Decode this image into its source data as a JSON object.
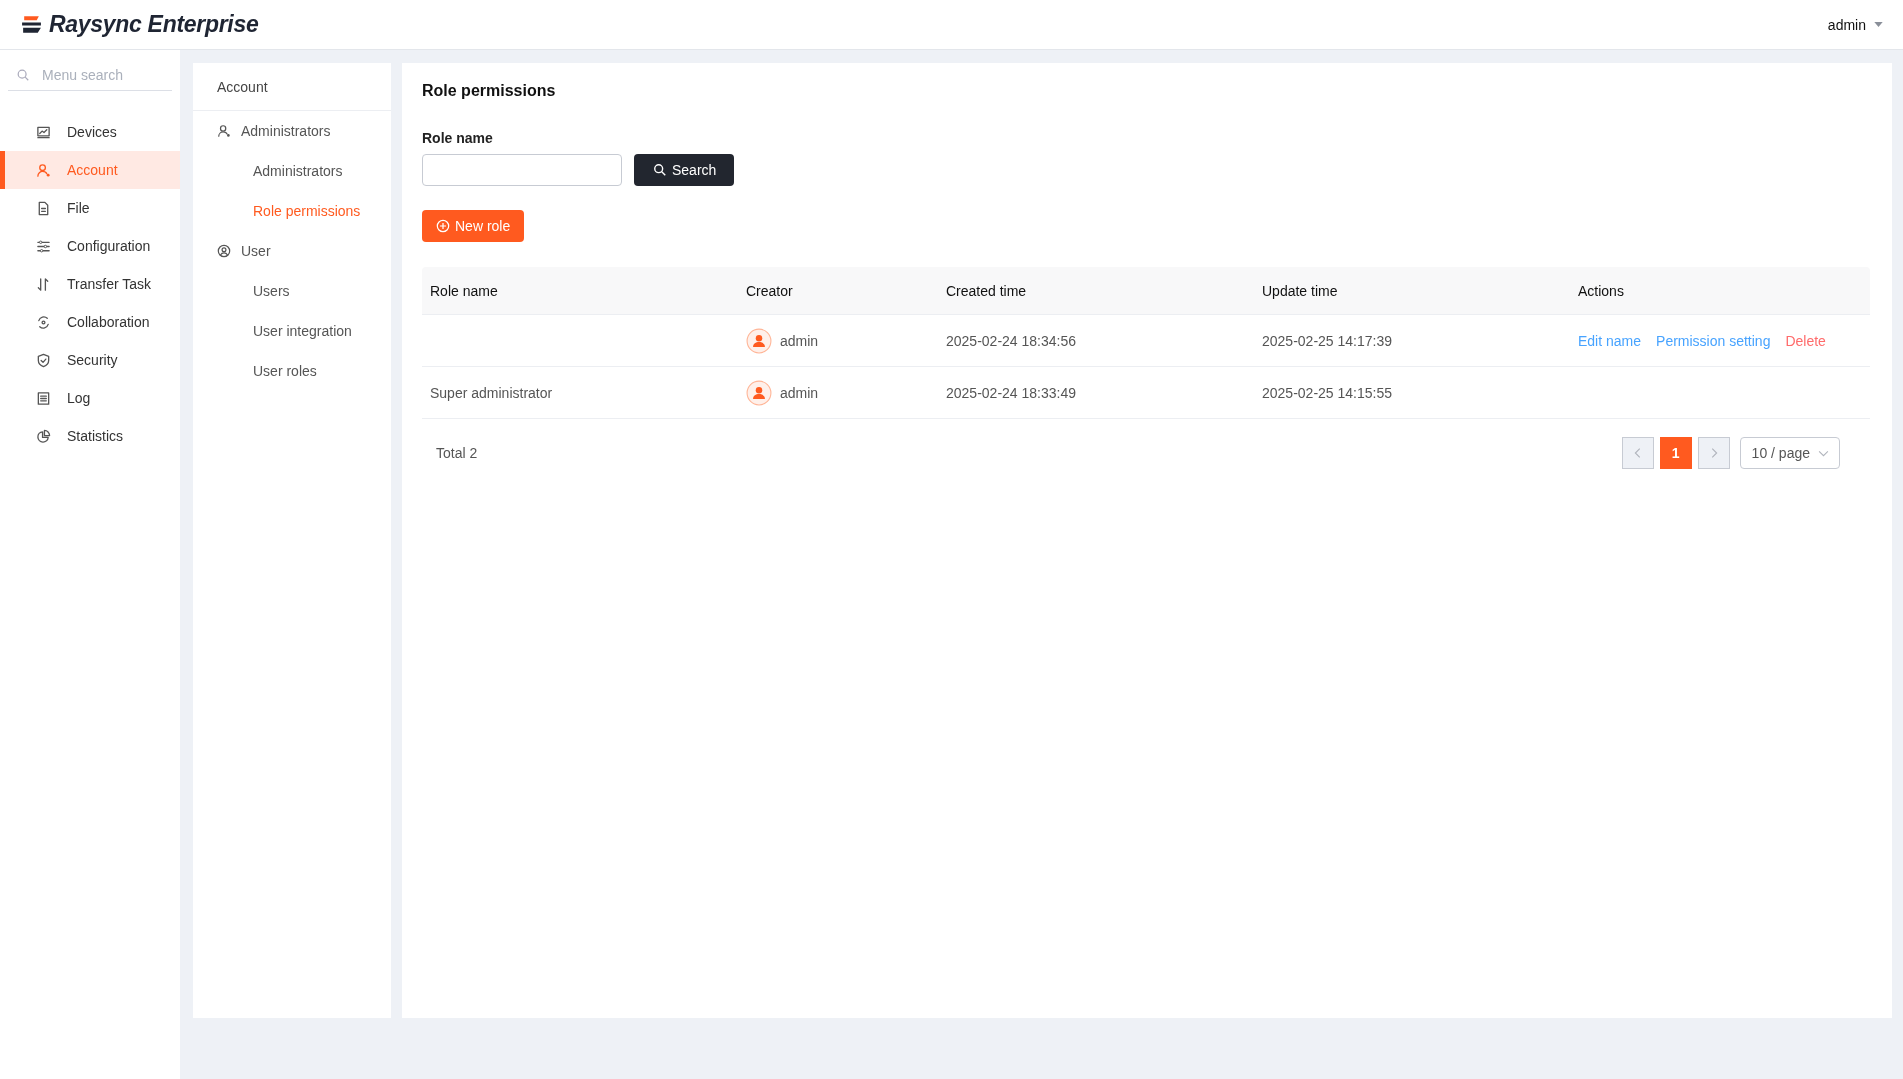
{
  "header": {
    "logo_text": "Raysync Enterprise",
    "user": "admin"
  },
  "sidebar": {
    "search_placeholder": "Menu search",
    "items": [
      {
        "label": "Devices",
        "selected": false
      },
      {
        "label": "Account",
        "selected": true
      },
      {
        "label": "File",
        "selected": false
      },
      {
        "label": "Configuration",
        "selected": false
      },
      {
        "label": "Transfer Task",
        "selected": false
      },
      {
        "label": "Collaboration",
        "selected": false
      },
      {
        "label": "Security",
        "selected": false
      },
      {
        "label": "Log",
        "selected": false
      },
      {
        "label": "Statistics",
        "selected": false
      }
    ]
  },
  "submenu": {
    "title": "Account",
    "groups": [
      {
        "label": "Administrators",
        "children": [
          {
            "label": "Administrators",
            "selected": false
          },
          {
            "label": "Role permissions",
            "selected": true
          }
        ]
      },
      {
        "label": "User",
        "children": [
          {
            "label": "Users",
            "selected": false
          },
          {
            "label": "User integration",
            "selected": false
          },
          {
            "label": "User roles",
            "selected": false
          }
        ]
      }
    ]
  },
  "main": {
    "title": "Role permissions",
    "filter_label": "Role name",
    "search_button": "Search",
    "new_button": "New role",
    "table": {
      "columns": [
        "Role name",
        "Creator",
        "Created time",
        "Update time",
        "Actions"
      ],
      "rows": [
        {
          "creator": "admin",
          "created": "2025-02-24 18:34:56",
          "updated": "2025-02-25 14:17:39",
          "actions": [
            {
              "label": "Edit name",
              "kind": "normal"
            },
            {
              "label": "Permission setting",
              "kind": "normal"
            },
            {
              "label": "Delete",
              "kind": "danger"
            }
          ]
        },
        {
          "role_name": "Super administrator",
          "creator": "admin",
          "created": "2025-02-24 18:33:49",
          "updated": "2025-02-25 14:15:55"
        }
      ]
    },
    "pagination": {
      "total": "Total 2",
      "pages": [
        {
          "label": "1",
          "selected": true
        }
      ],
      "page_size": "10 / page"
    }
  }
}
